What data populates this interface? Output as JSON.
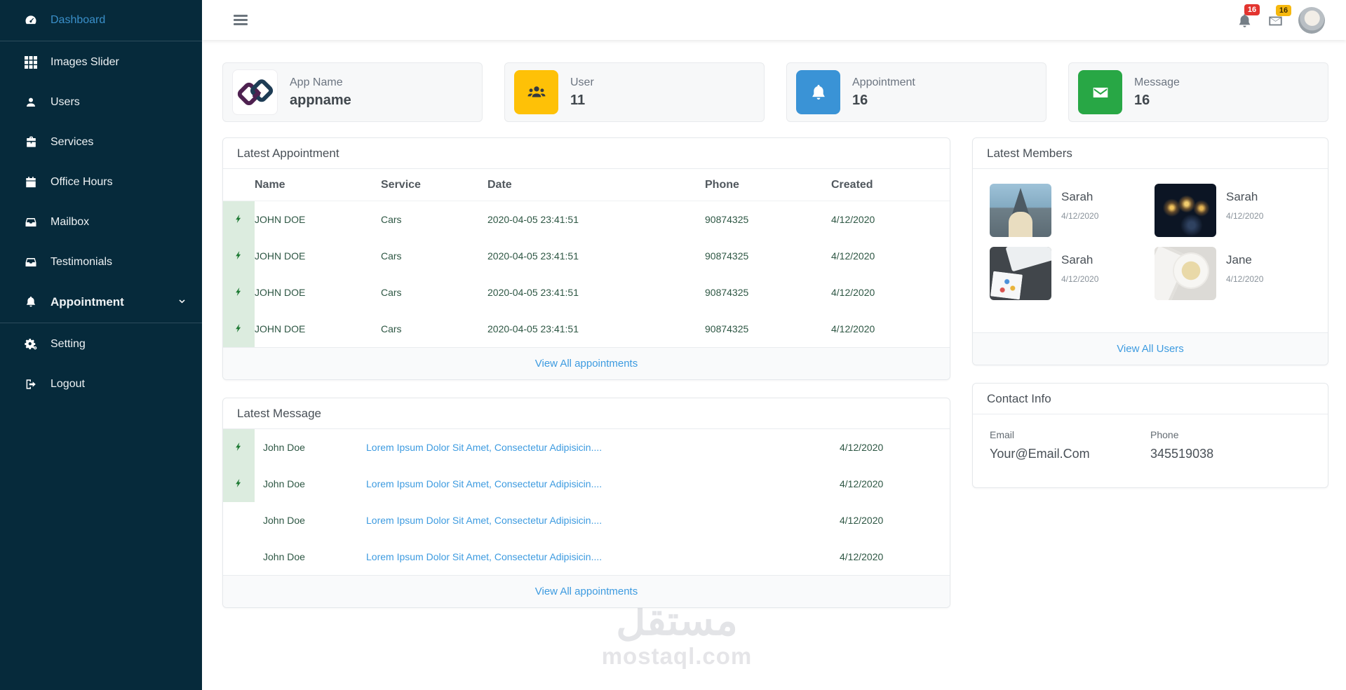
{
  "sidebar": {
    "items": [
      {
        "label": "Dashboard",
        "icon": "tachometer",
        "active": true,
        "divider_after": true
      },
      {
        "label": "Images Slider",
        "icon": "grid"
      },
      {
        "label": "Users",
        "icon": "user"
      },
      {
        "label": "Services",
        "icon": "briefcase"
      },
      {
        "label": "Office Hours",
        "icon": "calendar"
      },
      {
        "label": "Mailbox",
        "icon": "inbox"
      },
      {
        "label": "Testimonials",
        "icon": "inbox"
      },
      {
        "label": "Appointment",
        "icon": "bell",
        "bold": true,
        "chevron": "chevron-down",
        "divider_after": true
      },
      {
        "label": "Setting",
        "icon": "cogs"
      },
      {
        "label": "Logout",
        "icon": "sign-out"
      }
    ]
  },
  "topbar": {
    "menu_icon": "hamburger-icon",
    "bell_icon": "bell-icon",
    "bell_badge": "16",
    "mail_icon": "envelope-icon",
    "mail_badge": "16",
    "avatar": "user-avatar"
  },
  "stat_cards": [
    {
      "label": "App Name",
      "value": "appname",
      "icon": "app-logo",
      "icon_bg": "#ffffff"
    },
    {
      "label": "User",
      "value": "11",
      "icon": "users",
      "icon_bg": "#fec107"
    },
    {
      "label": "Appointment",
      "value": "16",
      "icon": "bell",
      "icon_bg": "#3a93d6"
    },
    {
      "label": "Message",
      "value": "16",
      "icon": "envelope",
      "icon_bg": "#28a745"
    }
  ],
  "appointments": {
    "title": "Latest Appointment",
    "columns": [
      "Name",
      "Service",
      "Date",
      "Phone",
      "Created"
    ],
    "row_icon": "bolt-icon",
    "rows": [
      {
        "name": "JOHN DOE",
        "service": "Cars",
        "date": "2020-04-05 23:41:51",
        "phone": "90874325",
        "created": "4/12/2020"
      },
      {
        "name": "JOHN DOE",
        "service": "Cars",
        "date": "2020-04-05 23:41:51",
        "phone": "90874325",
        "created": "4/12/2020"
      },
      {
        "name": "JOHN DOE",
        "service": "Cars",
        "date": "2020-04-05 23:41:51",
        "phone": "90874325",
        "created": "4/12/2020"
      },
      {
        "name": "JOHN DOE",
        "service": "Cars",
        "date": "2020-04-05 23:41:51",
        "phone": "90874325",
        "created": "4/12/2020"
      }
    ],
    "footer_link": "View All appointments"
  },
  "messages": {
    "title": "Latest Message",
    "row_icon": "bolt-icon",
    "rows": [
      {
        "name": "John Doe",
        "message": "Lorem Ipsum Dolor Sit Amet, Consectetur Adipisicin....",
        "date": "4/12/2020",
        "highlight": true
      },
      {
        "name": "John Doe",
        "message": "Lorem Ipsum Dolor Sit Amet, Consectetur Adipisicin....",
        "date": "4/12/2020",
        "highlight": true
      },
      {
        "name": "John Doe",
        "message": "Lorem Ipsum Dolor Sit Amet, Consectetur Adipisicin....",
        "date": "4/12/2020",
        "highlight": false
      },
      {
        "name": "John Doe",
        "message": "Lorem Ipsum Dolor Sit Amet, Consectetur Adipisicin....",
        "date": "4/12/2020",
        "highlight": false
      }
    ],
    "footer_link": "View All appointments"
  },
  "members": {
    "title": "Latest Members",
    "items": [
      {
        "name": "Sarah",
        "date": "4/12/2020",
        "photo": "temple"
      },
      {
        "name": "Sarah",
        "date": "4/12/2020",
        "photo": "fireworks"
      },
      {
        "name": "Sarah",
        "date": "4/12/2020",
        "photo": "desk"
      },
      {
        "name": "Jane",
        "date": "4/12/2020",
        "photo": "food"
      }
    ],
    "footer_link": "View All Users"
  },
  "contact": {
    "title": "Contact Info",
    "email_label": "Email",
    "email_value": "Your@Email.Com",
    "phone_label": "Phone",
    "phone_value": "345519038"
  },
  "watermark": {
    "logo_text": "مستقل",
    "domain": "mostaql.com"
  },
  "colors": {
    "sidebar_bg": "#062a3b",
    "active_link": "#3a8fc9",
    "link_blue": "#3d9be0",
    "stripe_green": "#dcecdf",
    "bolt_green": "#1e7a34",
    "badge_red": "#e3342f",
    "badge_yellow": "#f6b80e",
    "stat_yellow": "#fec107",
    "stat_blue": "#3a93d6",
    "stat_green": "#28a745"
  }
}
